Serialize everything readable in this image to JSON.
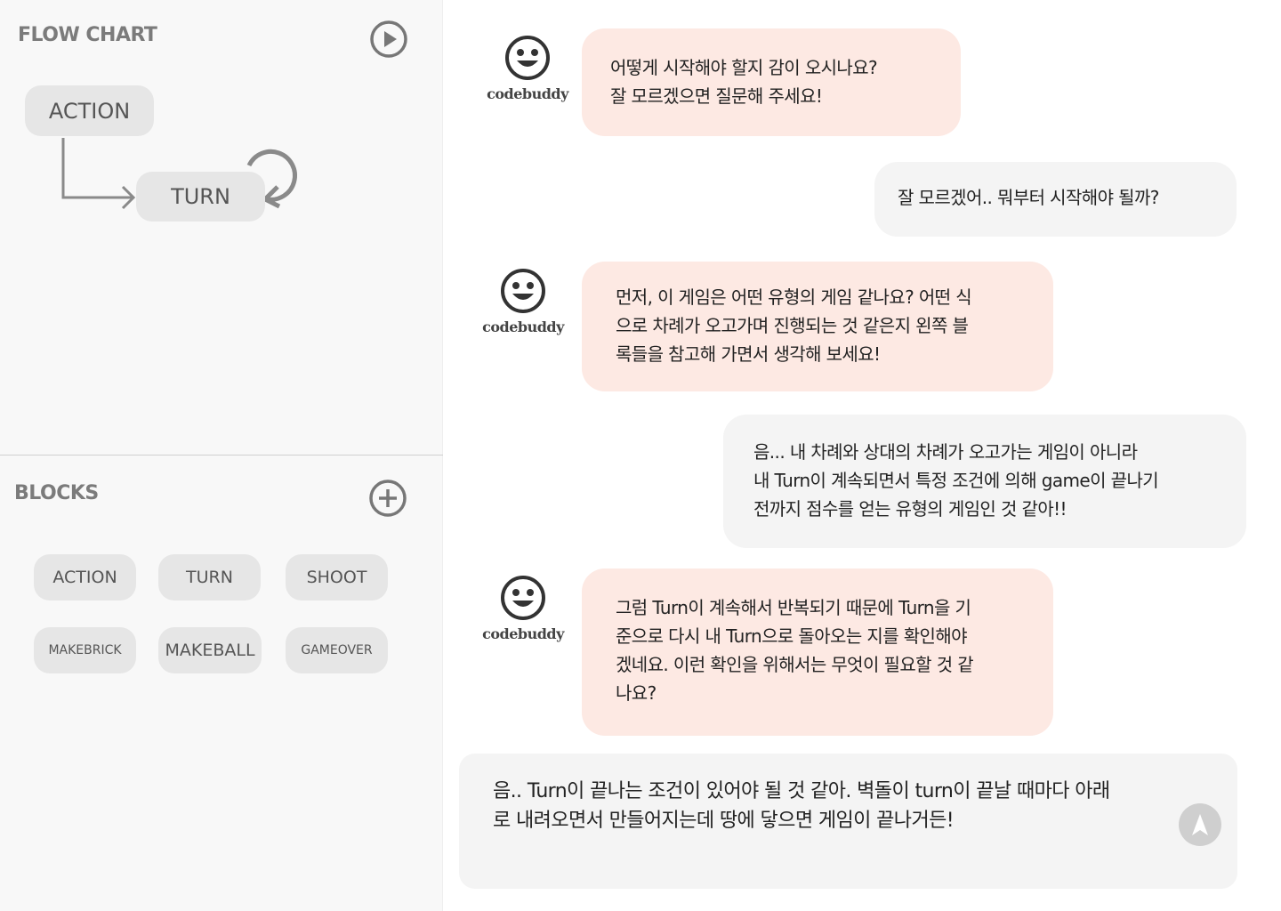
{
  "flowchart": {
    "title": "FLOW CHART",
    "play_icon": "play-circle-icon",
    "nodes": [
      {
        "label": "ACTION"
      },
      {
        "label": "TURN"
      }
    ],
    "loop_icon": "loop-arrow-icon"
  },
  "blocks": {
    "title": "BLOCKS",
    "add_icon": "plus-circle-icon",
    "items": [
      {
        "label": "ACTION"
      },
      {
        "label": "TURN"
      },
      {
        "label": "SHOOT"
      },
      {
        "label": "MAKEBRICK"
      },
      {
        "label": "MAKEBALL"
      },
      {
        "label": "GAMEOVER"
      }
    ]
  },
  "chat": {
    "bot_name": "codebuddy",
    "bot_icon": "smiley-face-icon",
    "messages": [
      {
        "sender": "bot",
        "text": "어떻게 시작해야 할지 감이 오시나요?\n잘 모르겠으면 질문해 주세요!"
      },
      {
        "sender": "user",
        "text": "잘 모르겠어.. 뭐부터 시작해야 될까?"
      },
      {
        "sender": "bot",
        "text": "먼저, 이 게임은 어떤 유형의 게임 같나요? 어떤 식\n으로 차례가 오고가며 진행되는 것 같은지 왼쪽 블\n록들을 참고해 가면서 생각해 보세요!"
      },
      {
        "sender": "user",
        "text": "음... 내 차례와 상대의 차례가 오고가는 게임이 아니라\n내 Turn이 계속되면서 특정 조건에 의해 game이 끝나기\n전까지 점수를 얻는 유형의 게임인 것 같아!!"
      },
      {
        "sender": "bot",
        "text": "그럼 Turn이 계속해서 반복되기 때문에 Turn을 기\n준으로 다시 내 Turn으로 돌아오는 지를 확인해야\n겠네요. 이런 확인을 위해서는 무엇이 필요할 것 같\n나요?"
      }
    ],
    "input": {
      "value": "음.. Turn이 끝나는 조건이 있어야 될 것 같아. 벽돌이 turn이 끝날 때마다 아래\n로 내려오면서 만들어지는데 땅에 닿으면 게임이 끝나거든!",
      "send_icon": "send-arrow-icon"
    }
  },
  "colors": {
    "left_bg": "#f8f8f8",
    "node_bg": "#e6e6e6",
    "bot_bubble": "#fde9e3",
    "user_bubble": "#f4f4f4",
    "title_gray": "#7b7b7b"
  }
}
